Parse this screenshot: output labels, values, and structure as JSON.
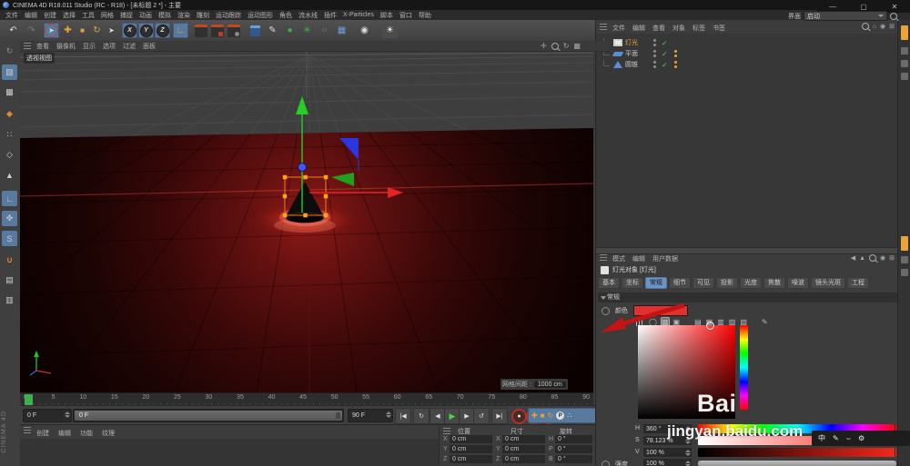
{
  "window": {
    "title": "CINEMA 4D R18.011 Studio (RC - R18) - [未标题 2 *] - 主要",
    "minimize": "—",
    "maximize": "▢",
    "close": "✕"
  },
  "menu_bar": {
    "items": [
      "文件",
      "编辑",
      "创建",
      "选择",
      "工具",
      "网格",
      "捕捉",
      "动画",
      "模拟",
      "渲染",
      "雕刻",
      "运动跟踪",
      "运动图形",
      "角色",
      "流水线",
      "插件",
      "X-Particles",
      "脚本",
      "窗口",
      "帮助"
    ]
  },
  "interface_selector": {
    "label": "界面",
    "value": "启动"
  },
  "viewport": {
    "menus": [
      "查看",
      "摄像机",
      "显示",
      "选项",
      "过滤",
      "面板"
    ],
    "label": "透视视图",
    "grid_label": "网格间距 :",
    "grid_value": "1000 cm"
  },
  "object_manager": {
    "menus": [
      "文件",
      "编辑",
      "查看",
      "对象",
      "标签",
      "书签"
    ],
    "objects": [
      {
        "name": "灯光",
        "icon": "light",
        "selected": true,
        "tags": false
      },
      {
        "name": "平面",
        "icon": "plane",
        "tags": true
      },
      {
        "name": "圆锥",
        "icon": "cone",
        "tags": true
      }
    ]
  },
  "attribute_manager": {
    "menus": [
      "模式",
      "编辑",
      "用户数据"
    ],
    "object_title": "灯光对象 [灯光]",
    "tabs": [
      {
        "label": "基本"
      },
      {
        "label": "坐标"
      },
      {
        "label": "常规",
        "active": true
      },
      {
        "label": "细节"
      },
      {
        "label": "可见"
      },
      {
        "label": "投影"
      },
      {
        "label": "光度"
      },
      {
        "label": "焦散"
      },
      {
        "label": "噪波"
      },
      {
        "label": "镜头光斑"
      },
      {
        "label": "工程"
      }
    ],
    "section": "常规",
    "color_label": "颜色",
    "swatch_color": "#e03030",
    "hsv": {
      "h_label": "H",
      "h_value": "360 °",
      "s_label": "S",
      "s_value": "78.123 %",
      "v_label": "V",
      "v_value": "100 %"
    },
    "intensity_label": "强度",
    "intensity_value": "100 %"
  },
  "timeline": {
    "ticks": [
      "0",
      "5",
      "10",
      "15",
      "20",
      "25",
      "30",
      "35",
      "40",
      "45",
      "50",
      "55",
      "60",
      "65",
      "70",
      "75",
      "80",
      "85",
      "90"
    ],
    "current": "0 F",
    "slider_text": "0 F",
    "range_end": "90 F"
  },
  "coordinates": {
    "headers": [
      "位置",
      "尺寸",
      "旋转"
    ],
    "rows": [
      {
        "axis": "X",
        "pos": "0 cm",
        "size_axis": "X",
        "size": "0 cm",
        "rot_axis": "H",
        "rot": "0 °"
      },
      {
        "axis": "Y",
        "pos": "0 cm",
        "size_axis": "Y",
        "size": "0 cm",
        "rot_axis": "P",
        "rot": "0 °"
      },
      {
        "axis": "Z",
        "pos": "0 cm",
        "size_axis": "Z",
        "size": "0 cm",
        "rot_axis": "B",
        "rot": "0 °"
      }
    ]
  },
  "materials_panel": {
    "menus": [
      "创建",
      "编辑",
      "功能",
      "纹理"
    ]
  },
  "watermark": {
    "big": "Bai",
    "small": "jingyan.baidu.com"
  },
  "side_label": "CINEMA 4D",
  "ime": {
    "lang": "中"
  },
  "icons": {
    "undo": "↶",
    "redo": "↷",
    "select": "➤",
    "move": "✚",
    "scale": "■",
    "rotate": "↻",
    "axis_x": "X",
    "axis_y": "Y",
    "axis_z": "Z",
    "coord_sys": "∟",
    "pen": "✎",
    "sphere": "●",
    "cloner": "✳",
    "spline": "○",
    "floor": "▦",
    "camera": "◉",
    "light": "☀",
    "home": "⌂",
    "target": "◉",
    "panel": "⊞",
    "back": "◀",
    "up": "▲",
    "goto_start": "|◀",
    "loop": "↻",
    "prev": "◀",
    "play": "▶",
    "next": "▶",
    "reverse": "↺",
    "goto_end": "▶|",
    "rec1": "●",
    "rec2": "◉",
    "rec3": "?",
    "key_pos": "✚",
    "key_scale": "■",
    "key_rot": "↻",
    "key_param": "P",
    "key_pla": "∴",
    "commander": "∷",
    "check": "✓",
    "wheel": "◯",
    "spectrum": "▩",
    "image": "▣",
    "table1": "▤",
    "table2": "▦",
    "table3": "▥",
    "table4": "▨",
    "table5": "▧",
    "eyedropper": "✎",
    "pan": "✛",
    "maximize": "▦",
    "pal_convert": "↻",
    "pal_model": "▧",
    "pal_tex": "▩",
    "pal_wp": "◆",
    "pal_points": "∷",
    "pal_edges": "◇",
    "pal_polys": "▲",
    "pal_axis": "∟",
    "pal_solo": "✜",
    "pal_snap": "S",
    "pal_magnet": "∪",
    "pal_pl1": "▤",
    "pal_pl2": "▥",
    "ime_pen": "✎",
    "ime_smile": "⌣",
    "ime_gear": "⚙"
  }
}
